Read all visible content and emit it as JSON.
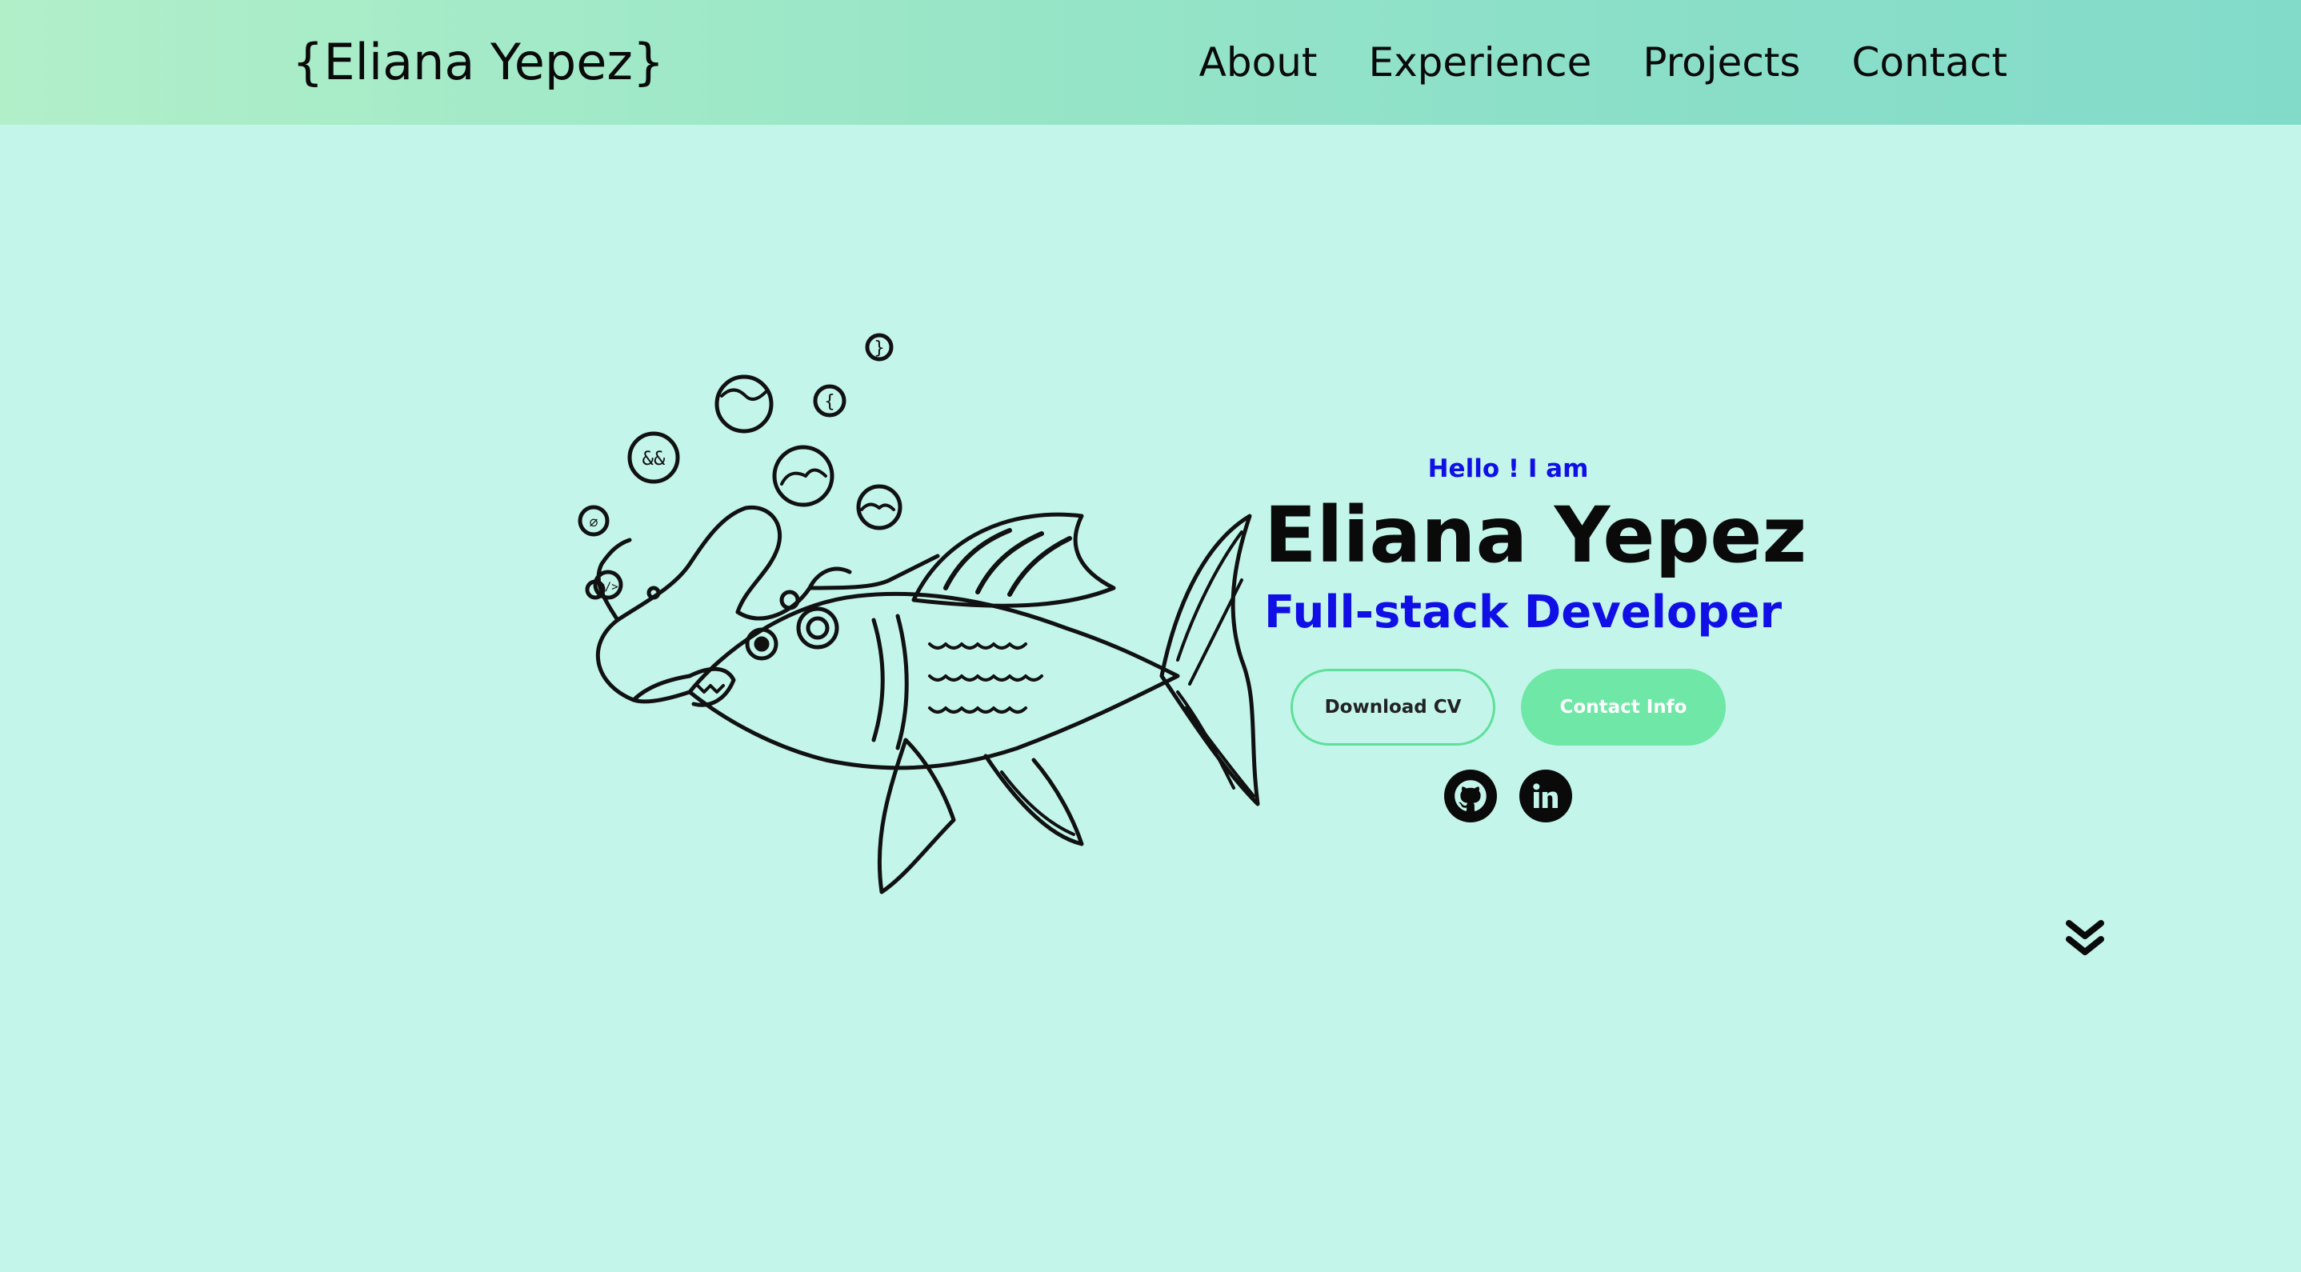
{
  "header": {
    "logo": "{Eliana Yepez}",
    "nav": [
      "About",
      "Experience",
      "Projects",
      "Contact"
    ]
  },
  "hero": {
    "greeting": "Hello ! I am",
    "name": "Eliana Yepez",
    "role": "Full-stack Developer",
    "buttons": {
      "download_cv": "Download CV",
      "contact_info": "Contact Info"
    },
    "socials": [
      "github-icon",
      "linkedin-icon"
    ]
  },
  "illustration": {
    "bubble_glyphs": [
      "}",
      "{",
      "&&",
      "</>",
      "∅"
    ]
  },
  "colors": {
    "background": "#c3f5ea",
    "accent_blue": "#1010e6",
    "accent_green": "#6fe7a6",
    "text": "#0a0a0a"
  },
  "icons": {
    "scroll": "chevron-double-down-icon"
  }
}
